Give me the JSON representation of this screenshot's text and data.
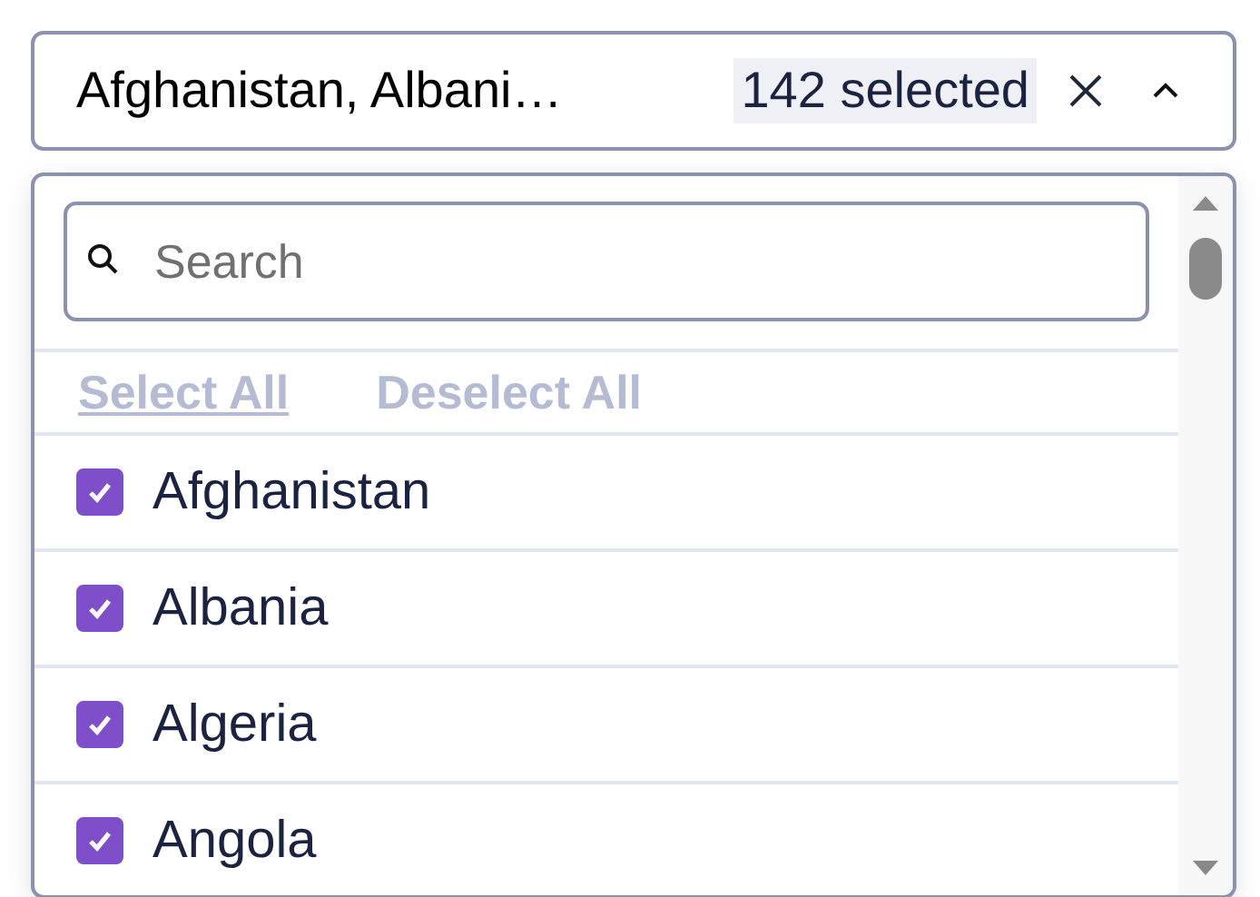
{
  "select": {
    "value": "Afghanistan, Albani…",
    "count_badge": "142 selected",
    "expanded": true
  },
  "search": {
    "placeholder": "Search"
  },
  "actions": [
    "Select All",
    "Deselect All"
  ],
  "options": [
    {
      "label": "Afghanistan",
      "checked": true
    },
    {
      "label": "Albania",
      "checked": true
    },
    {
      "label": "Algeria",
      "checked": true
    },
    {
      "label": "Angola",
      "checked": true
    }
  ]
}
